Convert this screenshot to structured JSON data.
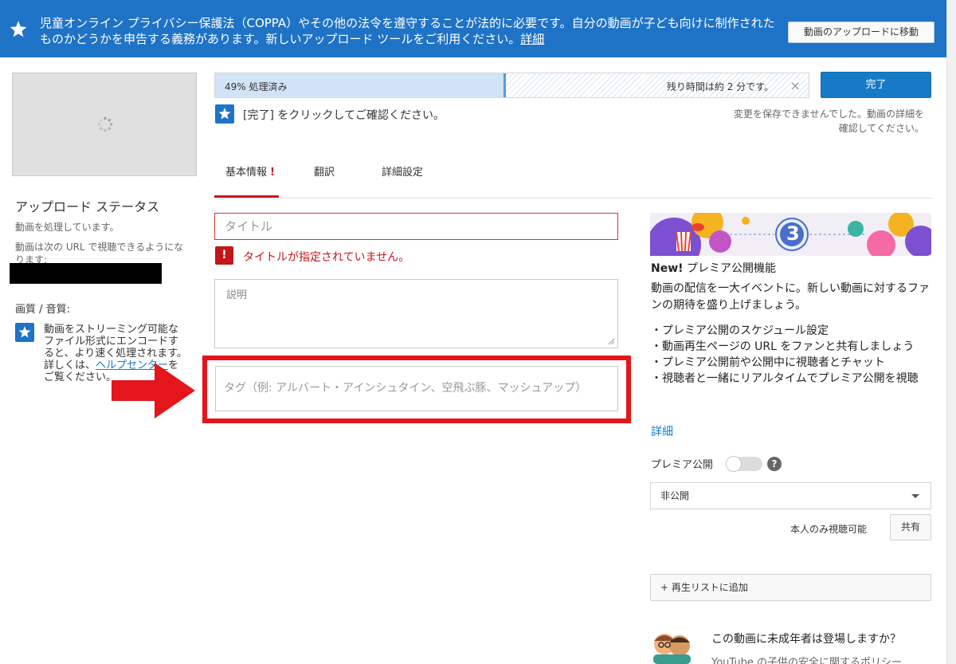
{
  "banner": {
    "text": "児童オンライン プライバシー保護法（COPPA）やその他の法令を遵守することが法的に必要です。自分の動画が子ども向けに制作されたものかどうかを申告する義務があります。新しいアップロード ツールをご利用ください。",
    "link": "詳細",
    "button": "動画のアップロードに移動"
  },
  "left": {
    "status_title": "アップロード ステータス",
    "processing": "動画を処理しています。",
    "url_note": "動画は次の URL で視聴できるようになります:",
    "quality_title": "画質 / 音質:",
    "quality_text_before": "動画をストリーミング可能なファイル形式にエンコードすると、より速く処理されます。詳しくは、",
    "quality_link": "ヘルプセンター",
    "quality_text_after": "をご覧ください。"
  },
  "progress": {
    "percent": 49,
    "label": "49% 処理済み",
    "remaining": "残り時間は約 2 分です。",
    "done_button": "完了"
  },
  "hint": "[完了] をクリックしてご確認ください。",
  "save_error": "変更を保存できませんでした。動画の詳細を確認してください。",
  "tabs": [
    {
      "label": "基本情報",
      "alert": "!"
    },
    {
      "label": "翻訳"
    },
    {
      "label": "詳細設定"
    }
  ],
  "form": {
    "title_placeholder": "タイトル",
    "title_error_icon": "!",
    "title_error": "タイトルが指定されていません。",
    "description_placeholder": "説明",
    "tags_placeholder": "タグ（例: アルバート・アインシュタイン、空飛ぶ豚、マッシュアップ）"
  },
  "premiere": {
    "banner_countdown": "3",
    "new_label": "New!",
    "title": "プレミア公開機能",
    "description": "動画の配信を一大イベントに。新しい動画に対するファンの期待を盛り上げましょう。",
    "features": [
      "・プレミア公開のスケジュール設定",
      "・動画再生ページの URL をファンと共有しましょう",
      "・プレミア公開前や公開中に視聴者とチャット",
      "・視聴者と一緒にリアルタイムでプレミア公開を視聴"
    ],
    "more_link": "詳細",
    "toggle_label": "プレミア公開",
    "help": "?"
  },
  "privacy": {
    "selected": "非公開",
    "note": "本人のみ視聴可能",
    "share_button": "共有"
  },
  "playlist_button": "+ 再生リストに追加",
  "kids": {
    "question": "この動画に未成年者は登場しますか？",
    "policy": "YouTube の子供の安全に関するポリシー"
  },
  "colors": {
    "banner_blue": "#1f73c6",
    "accent_blue": "#167ac6",
    "error_red": "#c4151a",
    "highlight_red": "#e4161b"
  }
}
